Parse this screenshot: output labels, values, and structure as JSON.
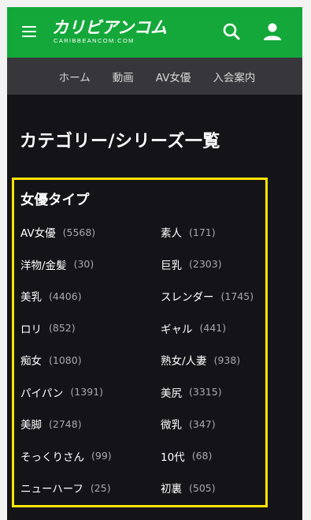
{
  "header": {
    "logo_text": "カリビアンコム",
    "logo_sub": "CARIBBEANCOM.COM",
    "menu_icon": "hamburger-menu-icon",
    "search_icon": "search-icon",
    "user_icon": "user-icon",
    "brand_color": "#14a83a"
  },
  "nav": {
    "items": [
      {
        "label": "ホーム"
      },
      {
        "label": "動画"
      },
      {
        "label": "AV女優"
      },
      {
        "label": "入会案内"
      }
    ]
  },
  "page": {
    "title": "カテゴリー/シリーズ一覧"
  },
  "section": {
    "title": "女優タイプ",
    "highlight_color": "#ffe400",
    "items": [
      {
        "name": "AV女優",
        "count": "(5568)"
      },
      {
        "name": "素人",
        "count": "(171)"
      },
      {
        "name": "洋物/金髪",
        "count": "(30)"
      },
      {
        "name": "巨乳",
        "count": "(2303)"
      },
      {
        "name": "美乳",
        "count": "(4406)"
      },
      {
        "name": "スレンダー",
        "count": "(1745)"
      },
      {
        "name": "ロリ",
        "count": "(852)"
      },
      {
        "name": "ギャル",
        "count": "(441)"
      },
      {
        "name": "痴女",
        "count": "(1080)"
      },
      {
        "name": "熟女/人妻",
        "count": "(938)"
      },
      {
        "name": "パイパン",
        "count": "(1391)"
      },
      {
        "name": "美尻",
        "count": "(3315)"
      },
      {
        "name": "美脚",
        "count": "(2748)"
      },
      {
        "name": "微乳",
        "count": "(347)"
      },
      {
        "name": "そっくりさん",
        "count": "(99)"
      },
      {
        "name": "10代",
        "count": "(68)"
      },
      {
        "name": "ニューハーフ",
        "count": "(25)"
      },
      {
        "name": "初裏",
        "count": "(505)"
      }
    ]
  }
}
